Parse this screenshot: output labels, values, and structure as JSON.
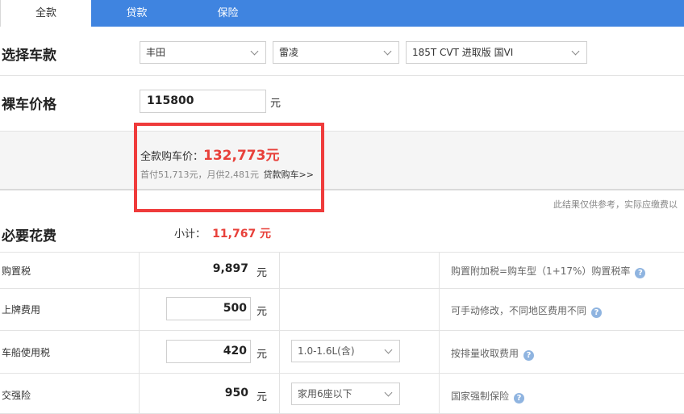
{
  "tabs": [
    {
      "label": "全款",
      "active": true
    },
    {
      "label": "贷款",
      "active": false
    },
    {
      "label": "保险",
      "active": false
    }
  ],
  "select_model": {
    "label": "选择车款",
    "brand": "丰田",
    "series": "雷凌",
    "trim": "185T CVT 进取版 国VI"
  },
  "price": {
    "label": "裸车价格",
    "value": "115800",
    "unit": "元"
  },
  "summary": {
    "total_label": "全款购车价：",
    "total_value": "132,773元",
    "sub_text": "首付51,713元，月供2,481元",
    "loan_link": "贷款购车>>",
    "disclaimer": "此结果仅供参考，实际应缴费以"
  },
  "required": {
    "label": "必要花费",
    "subtotal_label": "小计：",
    "subtotal_value": "11,767 元",
    "rows": [
      {
        "label": "购置税",
        "value": "9,897",
        "unit": "元",
        "note": "购置附加税=购车型（1+17%）购置税率"
      },
      {
        "label": "上牌费用",
        "value": "500",
        "unit": "元",
        "note": "可手动修改，不同地区费用不同"
      },
      {
        "label": "车船使用税",
        "value": "420",
        "unit": "元",
        "option": "1.0-1.6L(含)",
        "note": "按排量收取费用"
      },
      {
        "label": "交强险",
        "value": "950",
        "unit": "元",
        "option": "家用6座以下",
        "note": "国家强制保险"
      }
    ]
  },
  "icons": {
    "help": "question-circle-icon",
    "dropdown": "chevron-down-icon"
  },
  "colors": {
    "tab_bar": "#3f84e0",
    "accent_red": "#e8403a",
    "highlight_box": "#ef3b3b",
    "help_icon": "#8fb4e0"
  }
}
